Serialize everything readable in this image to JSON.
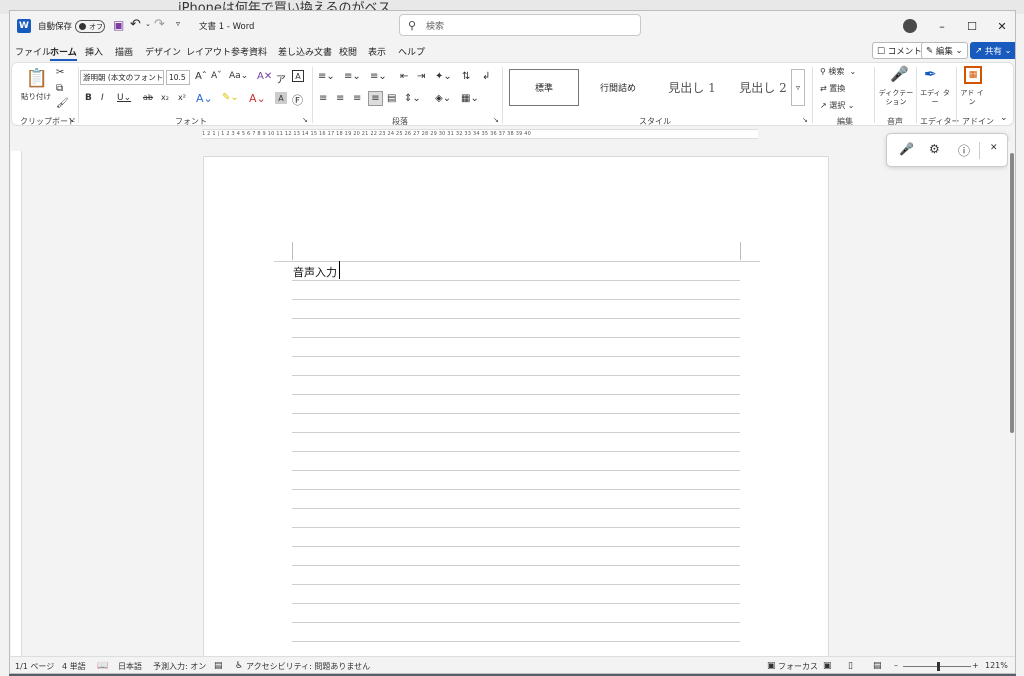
{
  "background": {
    "text": "iPhoneは何年で買い換えるのがベス"
  },
  "titlebar": {
    "autosave_label": "自動保存",
    "autosave_state": "オフ",
    "doc_title": "文書 1  -  Word",
    "search_placeholder": "検索"
  },
  "tabs": [
    "ファイル",
    "ホーム",
    "挿入",
    "描画",
    "デザイン",
    "レイアウト",
    "参考資料",
    "差し込み文書",
    "校閲",
    "表示",
    "ヘルプ"
  ],
  "topbuttons": {
    "comment": "コメント",
    "edit": "編集",
    "share": "共有"
  },
  "ribbon": {
    "paste": "貼り付け",
    "font_name": "游明朝 (本文のフォント",
    "font_size": "10.5",
    "styles": [
      "標準",
      "行間詰め",
      "見出し 1",
      "見出し 2"
    ],
    "find": "検索",
    "replace": "置換",
    "select": "選択",
    "dictate": "ディクテー ション",
    "editor": "エディ ター",
    "addins": "アド イン",
    "groups": {
      "clipboard": "クリップボード",
      "font": "フォント",
      "paragraph": "段落",
      "styles": "スタイル",
      "editing": "編集",
      "voice": "音声",
      "editor": "エディター",
      "addins": "アドイン"
    }
  },
  "ruler": {
    "ticks": "1 2 1 | 1 2 3 4 5 6 7 8 9 10 11 12 13 14 15 16 17 18 19 20 21 22 23 24 25 26 27 28 29 30 31 32 33 34 35 36 37 38 39 40"
  },
  "document": {
    "text": "音声入力"
  },
  "statusbar": {
    "page": "1/1 ページ",
    "words": "4 単語",
    "language": "日本語",
    "predict": "予測入力: オン",
    "accessibility": "アクセシビリティ: 問題ありません",
    "focus": "フォーカス",
    "zoom": "121%"
  },
  "colors": {
    "accent": "#185abd",
    "background": "#f3f3f3"
  }
}
